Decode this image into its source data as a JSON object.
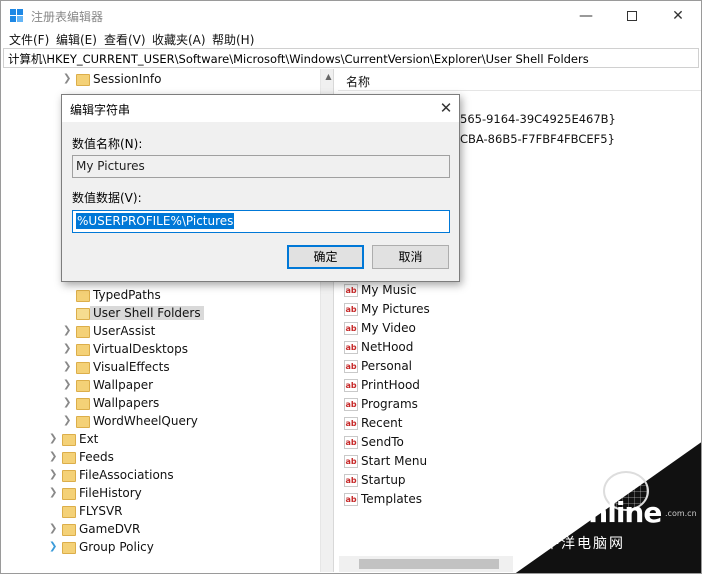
{
  "window": {
    "title": "注册表编辑器",
    "controls": {
      "minimize": "—",
      "close": "✕"
    }
  },
  "menu": [
    "文件(F)",
    "编辑(E)",
    "查看(V)",
    "收藏夹(A)",
    "帮助(H)"
  ],
  "address": "计算机\\HKEY_CURRENT_USER\\Software\\Microsoft\\Windows\\CurrentVersion\\Explorer\\User Shell Folders",
  "tree": {
    "items": [
      {
        "label": "SessionInfo",
        "expandable": true,
        "selected": false
      },
      {
        "label": "TypedPaths",
        "expandable": false,
        "selected": false
      },
      {
        "label": "User Shell Folders",
        "expandable": false,
        "selected": true
      },
      {
        "label": "UserAssist",
        "expandable": true,
        "selected": false
      },
      {
        "label": "VirtualDesktops",
        "expandable": true,
        "selected": false
      },
      {
        "label": "VisualEffects",
        "expandable": true,
        "selected": false
      },
      {
        "label": "Wallpaper",
        "expandable": true,
        "selected": false
      },
      {
        "label": "Wallpapers",
        "expandable": true,
        "selected": false
      },
      {
        "label": "WordWheelQuery",
        "expandable": true,
        "selected": false
      },
      {
        "label": "Ext",
        "expandable": true,
        "selected": false
      },
      {
        "label": "Feeds",
        "expandable": true,
        "selected": false
      },
      {
        "label": "FileAssociations",
        "expandable": true,
        "selected": false
      },
      {
        "label": "FileHistory",
        "expandable": true,
        "selected": false
      },
      {
        "label": "FLYSVR",
        "expandable": true,
        "selected": false
      },
      {
        "label": "GameDVR",
        "expandable": true,
        "selected": false
      },
      {
        "label": "Group Policy",
        "expandable": true,
        "selected": false
      }
    ]
  },
  "list": {
    "header": "名称",
    "partial_values": [
      "565-9164-39C4925E467B}",
      "CBA-86B5-F7FBF4FBCEF5}"
    ],
    "icon_text": "ab",
    "items": [
      "My Music",
      "My Pictures",
      "My Video",
      "NetHood",
      "Personal",
      "PrintHood",
      "Programs",
      "Recent",
      "SendTo",
      "Start Menu",
      "Startup",
      "Templates"
    ]
  },
  "dialog": {
    "title": "编辑字符串",
    "close": "✕",
    "name_label": "数值名称(N):",
    "name_value": "My Pictures",
    "data_label": "数值数据(V):",
    "data_value": "%USERPROFILE%\\Pictures",
    "ok_label": "确定",
    "cancel_label": "取消"
  },
  "watermark": {
    "logo": "PConline",
    "domain": ".com.cn",
    "chinese": "太平洋电脑网"
  }
}
